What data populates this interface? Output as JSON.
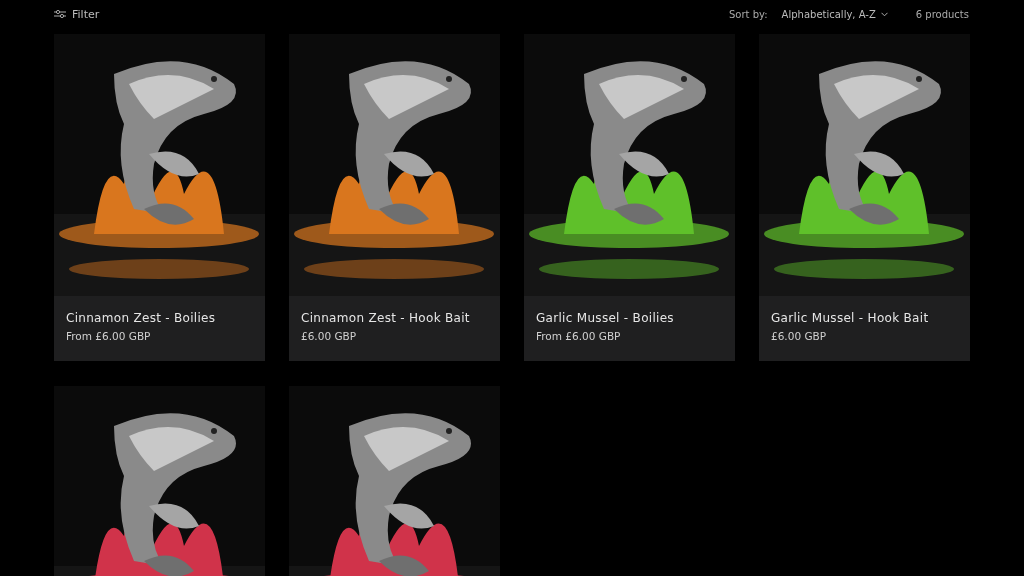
{
  "toolbar": {
    "filter_label": "Filter",
    "sort_label": "Sort by:",
    "sort_value": "Alphabetically, A-Z",
    "count": "6 products"
  },
  "products": [
    {
      "kind": "picture",
      "title": "Cinnamon Zest - Boilies",
      "price": "From £6.00 GBP"
    },
    {
      "kind": "picture",
      "title": "Cinnamon Zest - Hook Bait",
      "price": "£6.00 GBP"
    },
    {
      "kind": "picture",
      "title": "Garlic Mussel - Boilies",
      "price": "From £6.00 GBP"
    },
    {
      "kind": "picture",
      "title": "Garlic Mussel - Hook Bait",
      "price": "£6.00 GBP"
    },
    {
      "kind": "picture"
    },
    {
      "kind": "picture"
    }
  ]
}
